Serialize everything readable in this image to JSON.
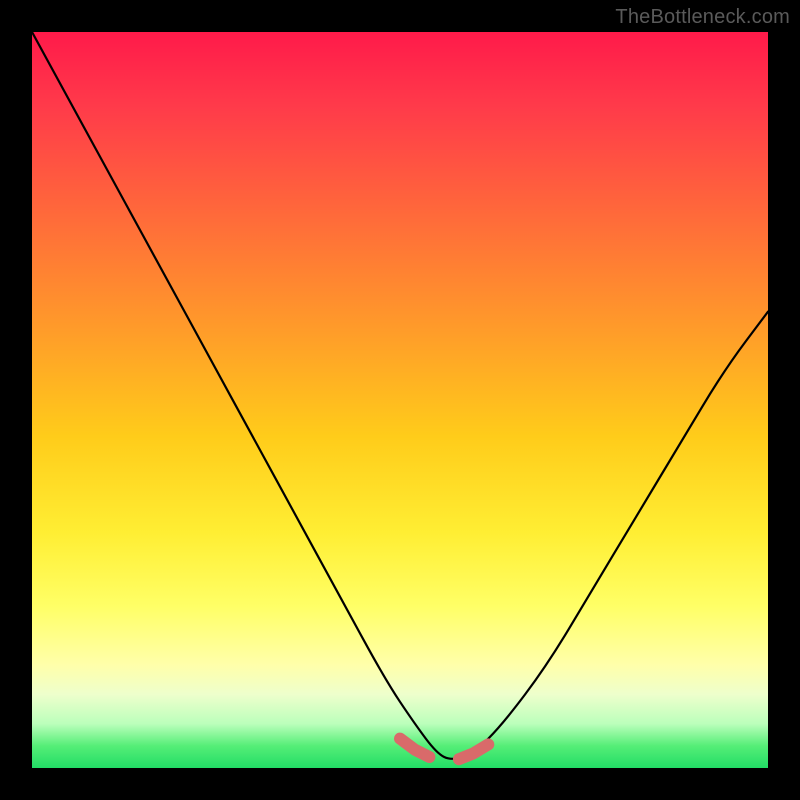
{
  "watermark": "TheBottleneck.com",
  "colors": {
    "curve_stroke": "#000000",
    "marker_stroke": "#d96a6a",
    "marker_fill": "#d96a6a",
    "frame": "#000000"
  },
  "chart_data": {
    "type": "line",
    "title": "",
    "xlabel": "",
    "ylabel": "",
    "xlim": [
      0,
      100
    ],
    "ylim": [
      0,
      100
    ],
    "grid": false,
    "legend": false,
    "note": "Bottleneck percentage curve. x = relative component balance (arbitrary 0–100 scale, no tick labels shown). y = bottleneck percentage (0 at bottom = no bottleneck/green, 100 at top = severe bottleneck/red). Curve is a V shape: steep descent from upper-left down to a minimum near x≈57, then rises toward upper-right. A short pink segment highlights the trough region.",
    "series": [
      {
        "name": "bottleneck-curve",
        "x": [
          0,
          6,
          12,
          18,
          24,
          30,
          36,
          42,
          48,
          52,
          55,
          57,
          60,
          64,
          70,
          76,
          82,
          88,
          94,
          100
        ],
        "y": [
          100,
          89,
          78,
          67,
          56,
          45,
          34,
          23,
          12,
          6,
          2,
          1,
          2,
          6,
          14,
          24,
          34,
          44,
          54,
          62
        ]
      },
      {
        "name": "highlight-markers",
        "x": [
          50,
          52,
          54,
          56,
          58,
          60,
          62
        ],
        "y": [
          4.0,
          2.5,
          1.5,
          1.0,
          1.2,
          2.0,
          3.2
        ]
      }
    ]
  }
}
